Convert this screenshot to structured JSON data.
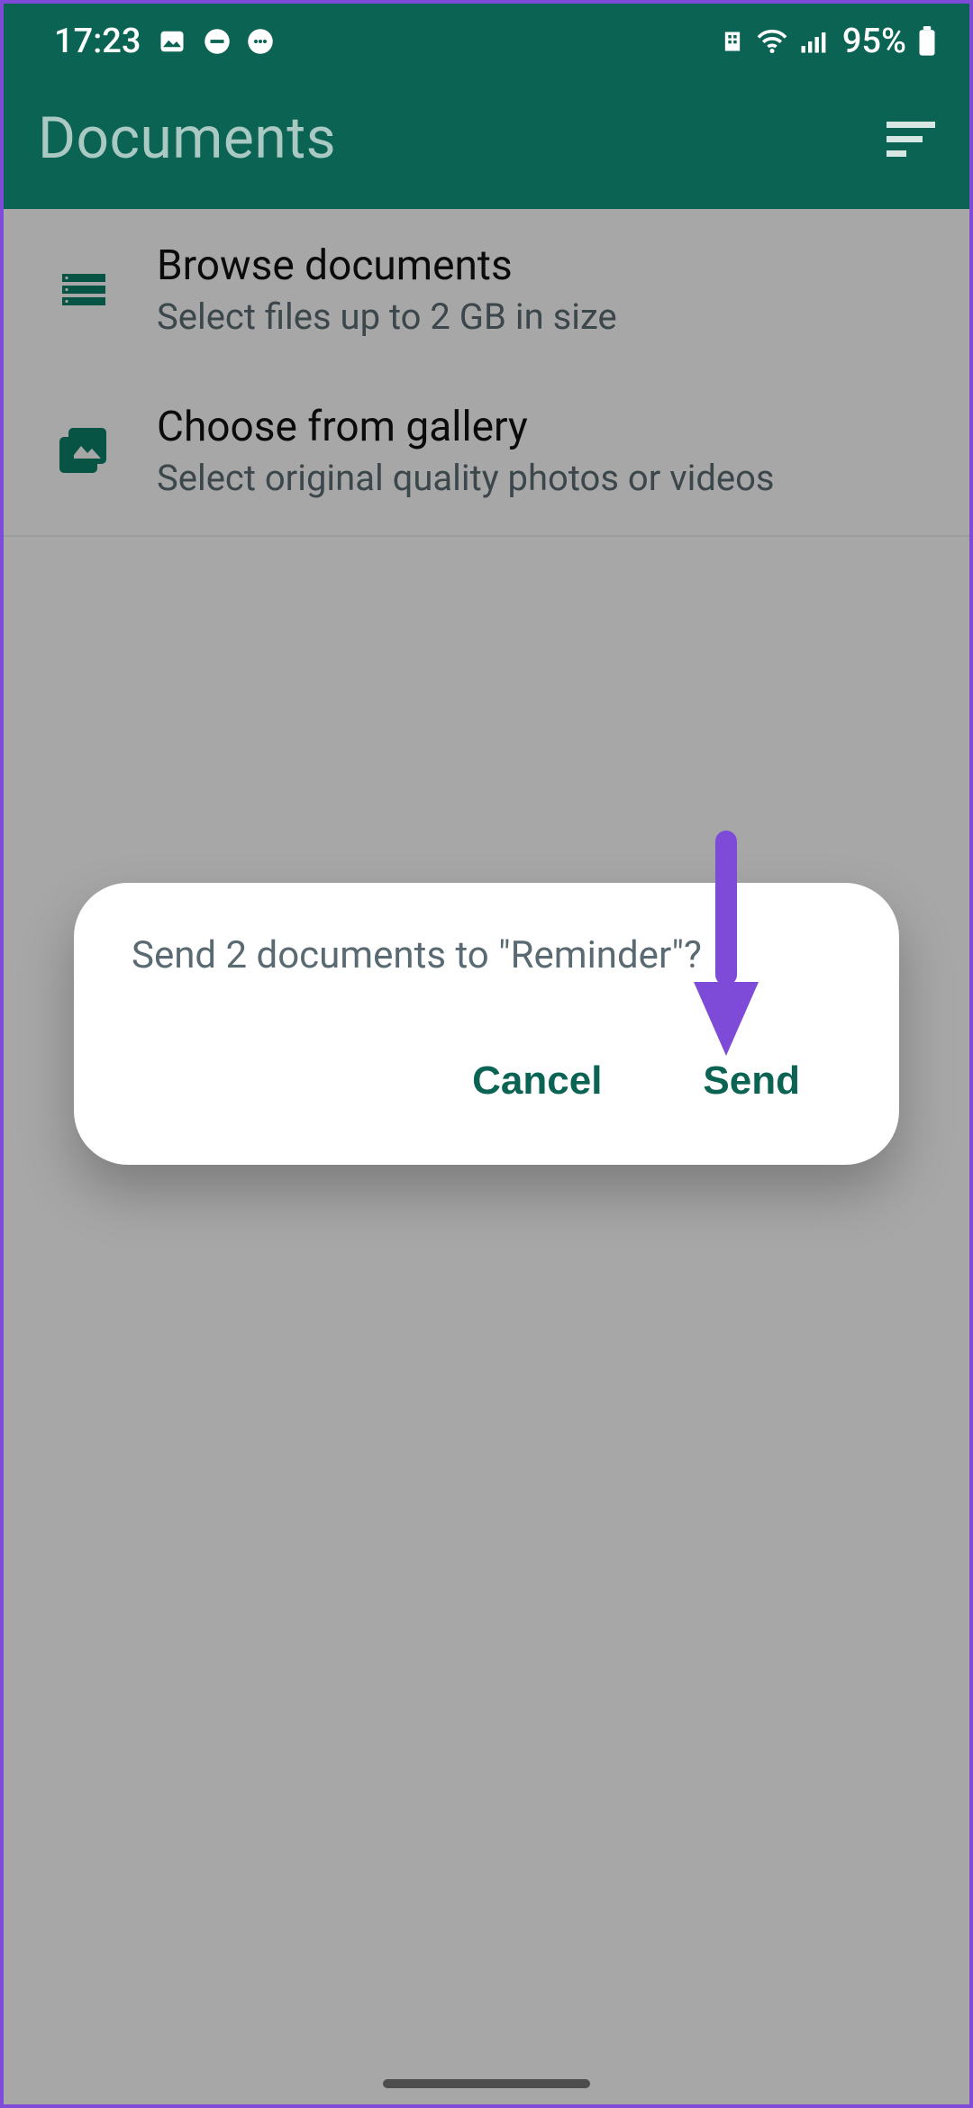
{
  "status": {
    "time": "17:23",
    "battery_text": "95%"
  },
  "appbar": {
    "title": "Documents"
  },
  "options": [
    {
      "title": "Browse documents",
      "subtitle": "Select files up to 2 GB in size"
    },
    {
      "title": "Choose from gallery",
      "subtitle": "Select original quality photos or videos"
    }
  ],
  "dialog": {
    "message": "Send 2 documents to \"Reminder\"?",
    "cancel_label": "Cancel",
    "send_label": "Send"
  },
  "colors": {
    "brand": "#0b6354",
    "annotation": "#7d4bd8"
  }
}
